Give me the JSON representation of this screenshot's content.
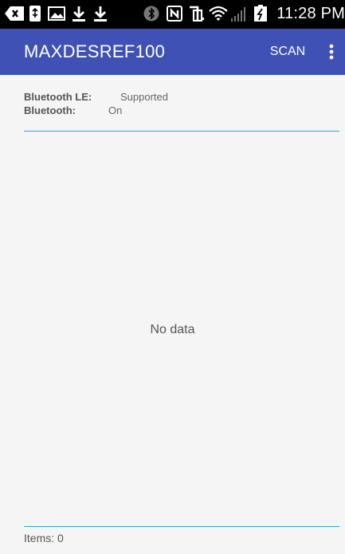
{
  "status_bar": {
    "time": "11:28 PM",
    "icons": [
      "back-arrow-icon",
      "usb-icon",
      "image-icon",
      "download-icon",
      "download-icon",
      "bluetooth-icon",
      "nfc-icon",
      "vibrate-icon",
      "wifi-icon",
      "signal-icon",
      "battery-charging-icon"
    ]
  },
  "app_bar": {
    "title": "MAXDESREF100",
    "scan_label": "SCAN",
    "color": "#3f51b5"
  },
  "info": {
    "ble_label": "Bluetooth LE:",
    "ble_value": "Supported",
    "bt_label": "Bluetooth:",
    "bt_value": "On"
  },
  "list": {
    "empty_text": "No data",
    "divider_color": "#29a8d6"
  },
  "footer": {
    "items_text": "Items: 0"
  }
}
